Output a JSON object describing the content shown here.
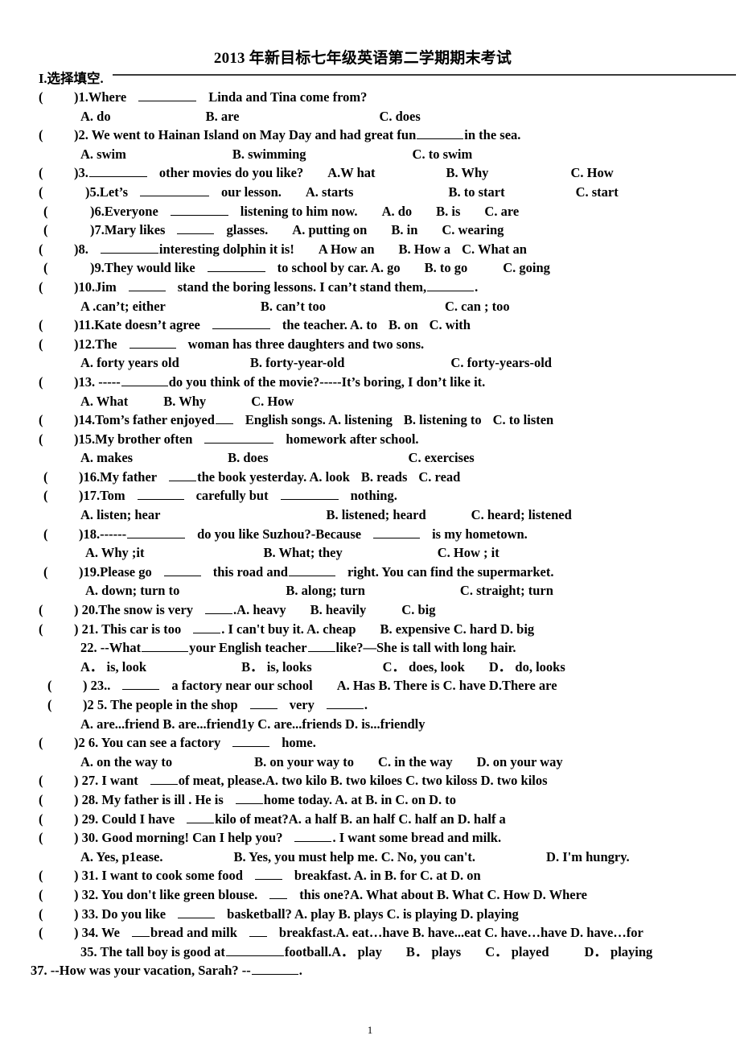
{
  "document": {
    "title": "2013 年新目标七年级英语第二学期期末考试",
    "section_heading": "I.选择填空.",
    "page_number": "1"
  },
  "questions": [
    {
      "id": "q1",
      "marker": "(",
      "close": ")1.Where",
      "stem_after": "Linda and Tina come from?",
      "options_line": "A. do",
      "options_b": "B. are",
      "options_c": "C. does"
    }
  ],
  "lines": [
    {
      "n": 1,
      "text": "(          )1.Where ______ Linda and Tina come from?"
    },
    {
      "n": 2,
      "text": "A. do                          B. are                               C. does"
    },
    {
      "n": 3,
      "text": "(          )2. We went to Hainan Island on May Day and had great fun______ in the sea."
    },
    {
      "n": 4,
      "text": "A. swim                        B. swimming                     C. to swim"
    },
    {
      "n": 5,
      "text": "(          )3.________ other movies do you like?   A.W hat            B. Why              C. How"
    },
    {
      "n": 6,
      "text": "(           )5.Let’s __________ our lesson.   A. starts            B. to start          C. start"
    },
    {
      "n": 7,
      "text": "(            )6.Everyone ________ listening to him now.   A. do      B. is      C. are"
    },
    {
      "n": 8,
      "text": "(            )7.Mary likes _____ glasses.    A. putting on      B. in       C. wearing"
    },
    {
      "n": 9,
      "text": "(          )8.  _________interesting dolphin it is!   A How an     B.  How a   C.   What an"
    },
    {
      "n": 10,
      "text": "(            )9.They would like ________ to school by car. A. go         B. to go          C. going"
    },
    {
      "n": 11,
      "text": "(          )10.Jim _____ stand the boring lessons. I can’t stand them,______."
    },
    {
      "n": 12,
      "text": "A .can’t; either                B. can’t too                   C. can ; too"
    },
    {
      "n": 13,
      "text": "(          )11.Kate doesn’t agree ________ the teacher. A. to    B. on    C. with"
    },
    {
      "n": 14,
      "text": "(          )12.The _______ woman has three daughters and two sons."
    },
    {
      "n": 15,
      "text": "A. forty years old           B. forty-year-old                  C. forty-years-old"
    },
    {
      "n": 16,
      "text": "(          )13. -----______do you think of   the movie?-----It’s boring, I don’t like it."
    },
    {
      "n": 17,
      "text": "A. What          B. Why            C. How"
    },
    {
      "n": 18,
      "text": "(          )14.Tom’s father enjoyed___ English songs. A. listening   B. listening to   C. to listen"
    },
    {
      "n": 19,
      "text": "(          )15.My brother often _________ homework   after school."
    },
    {
      "n": 20,
      "text": "A. makes                   B. does                            C. exercises"
    },
    {
      "n": 21,
      "text": "(          )16.My father ____the book yesterday. A. look    B. reads    C. read"
    },
    {
      "n": 22,
      "text": "(          )17.Tom _______ carefully but _________ nothing."
    },
    {
      "n": 23,
      "text": "A. listen; hear                        B. listened; heard        C. heard; listened"
    },
    {
      "n": 24,
      "text": "(          )18.------________ do you like Suzhou?-Because ________ is my hometown."
    },
    {
      "n": 25,
      "text": "A. Why ;it                           B. What; they                     C. How ; it"
    },
    {
      "n": 26,
      "text": "(          )19.Please go ______ this road and________ right. You can find the supermarket."
    },
    {
      "n": 27,
      "text": "A. down; turn to                  B. along; turn              C. straight; turn"
    },
    {
      "n": 28,
      "text": "(          ) 20.The snow is very ____.A. heavy     B. heavily       C. big"
    },
    {
      "n": 29,
      "text": "(          ) 21. This car is too ____. I can't buy it. A. cheap    B. expensive C. hard D. big"
    },
    {
      "n": 30,
      "text": "22.  --What_______your English teacher_____like?—She is tall with long hair."
    },
    {
      "n": 31,
      "text": "A． is, look             B． is, looks        C． does, look      D． do, looks"
    },
    {
      "n": 32,
      "text": "(          ) 23.. ______ a factory near our school    A. Has B. There is C. have D.There are"
    },
    {
      "n": 33,
      "text": "(          )2 5. The people in the shop _____ very ______."
    },
    {
      "n": 34,
      "text": "A. are...friend B. are...friend1y C. are...friends D. is...friendly"
    },
    {
      "n": 35,
      "text": "(          )2 6. You can see a factory ______ home."
    },
    {
      "n": 36,
      "text": "A. on the way to          B. on your way to     C. in the way      D. on your way"
    },
    {
      "n": 37,
      "text": "(          ) 27. I want ____of meat, please.A. two kilo B. two kiloes C. two kiloss D. two kilos"
    },
    {
      "n": 38,
      "text": "(          ) 28. My father is ill . He is ____home today.   A. at   B. in   C. on   D. to"
    },
    {
      "n": 39,
      "text": "(          ) 29. Could I have ____kilo of meat?A. a half B. an half C. half an D. half a"
    },
    {
      "n": 40,
      "text": "(          ) 30. Good morning! Can I help you? _____. I want some bread and milk."
    },
    {
      "n": 41,
      "text": "A. Yes, p1ease.          B. Yes, you must help me. C. No, you can't.        D. I'm hungry."
    },
    {
      "n": 42,
      "text": "(          ) 31. I want to cook some food ____ breakfast.   A. in B. for C. at D. on"
    },
    {
      "n": 43,
      "text": "(          ) 32. You don't like   green blouse. ___ this one?A. What about B. What C. How D. Where"
    },
    {
      "n": 44,
      "text": "(          ) 33. Do you like _____ basketball?     A. play B. plays C. is playing D. playing"
    },
    {
      "n": 45,
      "text": "(          ) 34. We __bread and milk __ breakfast.A. eat…have   B. have...eat C. have…have D. have…for"
    },
    {
      "n": 46,
      "text": "35. The tall boy is good at________football.A． play   B． plays   C． played    D． playing"
    },
    {
      "n": 47,
      "text": "37.  --How was your vacation, Sarah?   --______."
    }
  ],
  "text": {
    "t1_paren": "(",
    "t1_num": ")1.Where",
    "t1_rest": "Linda and Tina come from?",
    "t2_a": "A. do",
    "t2_b": "B. are",
    "t2_c": "C. does",
    "t3_num": ")2. We went to Hainan Island on May Day and had great fun",
    "t3_rest": "in the sea.",
    "t4_a": "A. swim",
    "t4_b": "B. swimming",
    "t4_c": "C. to swim",
    "t5_num": ")3.",
    "t5_rest": "other movies do you like?",
    "t5_a": "A.W hat",
    "t5_b": "B. Why",
    "t5_c": "C. How",
    "t6_num": ")5.Let’s",
    "t6_rest": "our lesson.",
    "t6_a": "A. starts",
    "t6_b": "B. to start",
    "t6_c": "C. start",
    "t7_num": ")6.Everyone",
    "t7_rest": "listening to him now.",
    "t7_a": "A. do",
    "t7_b": "B. is",
    "t7_c": "C. are",
    "t8_num": ")7.Mary likes",
    "t8_rest": "glasses.",
    "t8_a": "A. putting on",
    "t8_b": "B. in",
    "t8_c": "C. wearing",
    "t9_num": ")8.",
    "t9_rest": "interesting dolphin it is!",
    "t9_a": "A How an",
    "t9_b": "B.  How a",
    "t9_c": "C.   What an",
    "t10_num": ")9.They would like",
    "t10_rest": "to school by car. A. go",
    "t10_b": "B. to go",
    "t10_c": "C. going",
    "t11_num": ")10.Jim",
    "t11_mid": "stand the boring lessons. I can’t stand them,",
    "t11_end": ".",
    "t12_a": "A .can’t; either",
    "t12_b": "B. can’t too",
    "t12_c": "C. can ; too",
    "t13_num": ")11.Kate doesn’t agree",
    "t13_rest": "the teacher. A. to",
    "t13_b": "B. on",
    "t13_c": "C. with",
    "t14_num": ")12.The",
    "t14_rest": "woman has three daughters and two sons.",
    "t15_a": "A. forty years old",
    "t15_b": "B. forty-year-old",
    "t15_c": "C. forty-years-old",
    "t16_num": ")13. -----",
    "t16_rest": "do you think of   the movie?-----It’s boring, I don’t like it.",
    "t17_a": "A. What",
    "t17_b": "B. Why",
    "t17_c": "C. How",
    "t18_num": ")14.Tom’s father enjoyed",
    "t18_rest": "English songs. A. listening",
    "t18_b": "B. listening to",
    "t18_c": "C. to listen",
    "t19_num": ")15.My brother often",
    "t19_rest": "homework   after school.",
    "t20_a": "A. makes",
    "t20_b": "B. does",
    "t20_c": "C. exercises",
    "t21_num": ")16.My father",
    "t21_rest": "the book yesterday. A. look",
    "t21_b": "B. reads",
    "t21_c": "C. read",
    "t22_num": ")17.Tom",
    "t22_mid": "carefully but",
    "t22_end": "nothing.",
    "t23_a": "A. listen; hear",
    "t23_b": "B. listened; heard",
    "t23_c": "C. heard; listened",
    "t24_num": ")18.------",
    "t24_mid": "do you like Suzhou?-Because",
    "t24_end": "is my hometown.",
    "t25_a": "A. Why ;it",
    "t25_b": "B. What; they",
    "t25_c": "C. How ; it",
    "t26_num": ")19.Please go",
    "t26_mid": "this road and",
    "t26_end": "right. You can find the supermarket.",
    "t27_a": "A. down; turn to",
    "t27_b": "B. along; turn",
    "t27_c": "C. straight; turn",
    "t28_num": ") 20.The snow is very",
    "t28_rest": ".A. heavy",
    "t28_b": "B. heavily",
    "t28_c": "C. big",
    "t29_num": ") 21. This car is too",
    "t29_rest": ". I can't buy it. A. cheap",
    "t29_b": "B. expensive C. hard D. big",
    "t30_num": "22.  --What",
    "t30_mid": "your English teacher",
    "t30_end": "like?—She is tall with long hair.",
    "t31_a": "A． is, look",
    "t31_b": "B． is, looks",
    "t31_c": "C． does, look",
    "t31_d": "D． do, looks",
    "t32_num": ") 23..",
    "t32_rest": "a factory near our school",
    "t32_opts": "A. Has B. There is C. have D.There are",
    "t33_num": ")2 5. The people in the shop",
    "t33_mid": "very",
    "t33_end": ".",
    "t34_opts": "A. are...friend B. are...friend1y C. are...friends D. is...friendly",
    "t35_num": ")2 6. You can see a factory",
    "t35_rest": "home.",
    "t36_a": "A. on the way to",
    "t36_b": "B. on your way to",
    "t36_c": "C. in the way",
    "t36_d": "D. on your way",
    "t37_num": ") 27. I want",
    "t37_rest": "of meat, please.A. two kilo B. two kiloes C. two kiloss D. two kilos",
    "t38_num": ") 28. My father is ill . He is",
    "t38_rest": "home today.   A. at   B. in   C. on   D. to",
    "t39_num": ") 29. Could I have",
    "t39_rest": "kilo of meat?A. a half B. an half C. half an D. half a",
    "t40_num": ") 30. Good morning! Can I help you?",
    "t40_rest": ". I want some bread and milk.",
    "t41_a": "A. Yes, p1ease.",
    "t41_b": "B. Yes, you must help me. C. No, you can't.",
    "t41_d": "D. I'm hungry.",
    "t42_num": ") 31. I want to cook some food",
    "t42_rest": "breakfast.   A. in B. for C. at D. on",
    "t43_num": ") 32. You don't like   green blouse.",
    "t43_rest": "this one?A. What about B. What C. How D. Where",
    "t44_num": ") 33. Do you like",
    "t44_rest": "basketball?     A. play B. plays C. is playing D. playing",
    "t45_num": ") 34. We",
    "t45_mid": "bread and milk",
    "t45_end": "breakfast.A. eat…have   B. have...eat C. have…have D. have…for",
    "t46_num": "35. The tall boy is good at",
    "t46_rest": "football.A． play",
    "t46_b": "B． plays",
    "t46_c": "C． played",
    "t46_d": "D． playing",
    "t47_num": "37.  --How was your vacation, Sarah?   --",
    "t47_end": "."
  }
}
